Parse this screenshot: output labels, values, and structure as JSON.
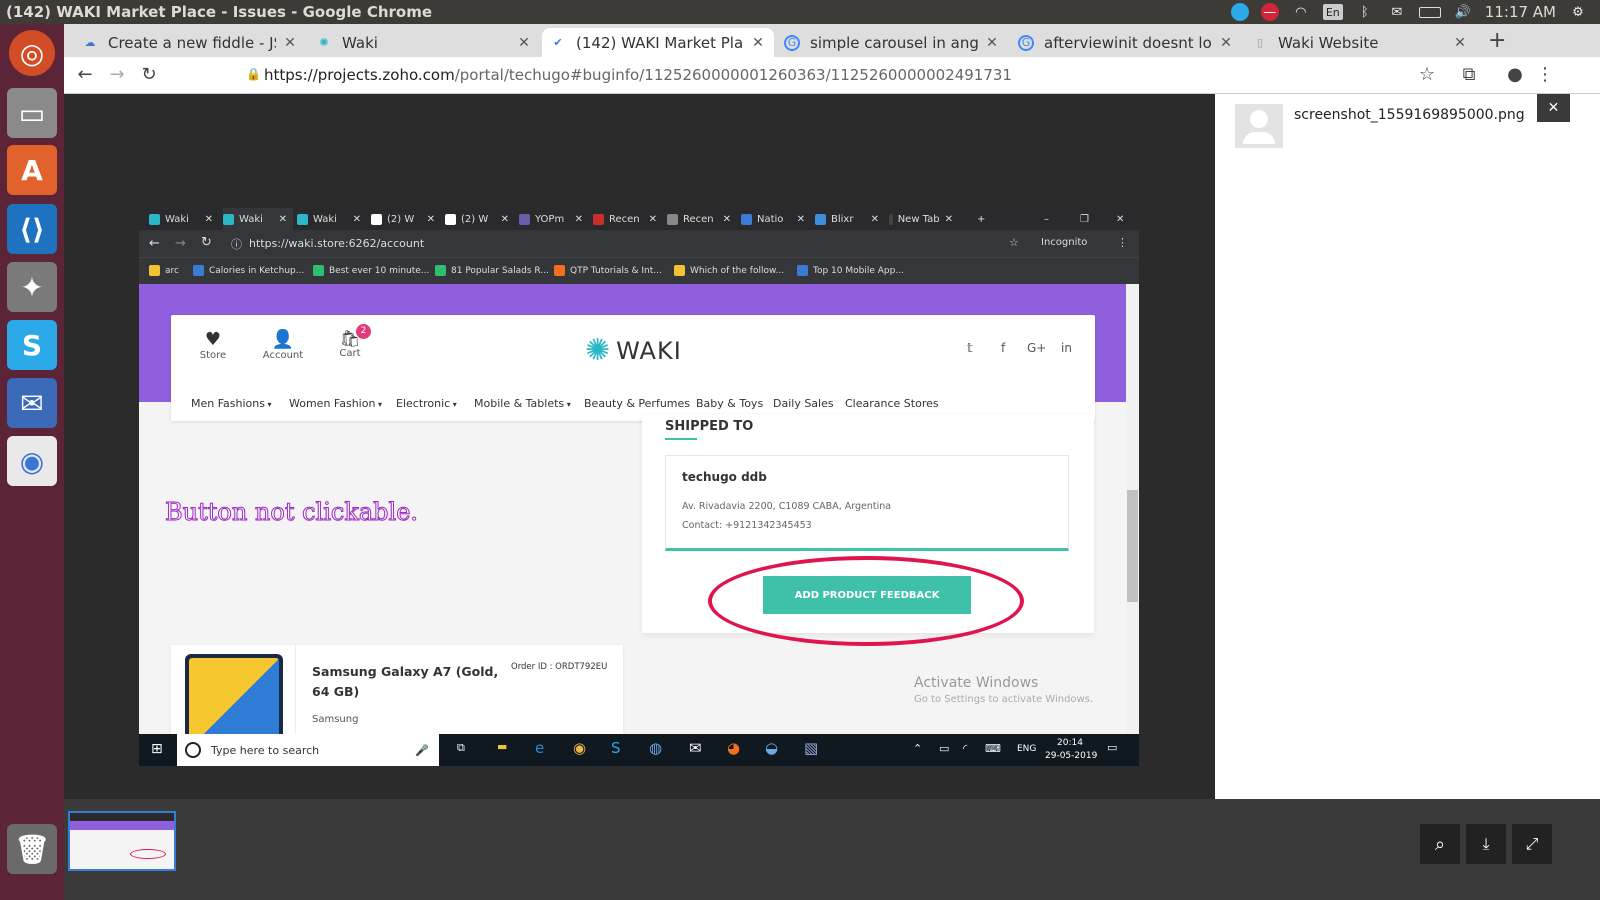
{
  "window_title": "(142) WAKI Market Place - Issues - Google Chrome",
  "tray": {
    "lang": "En",
    "time": "11:17 AM"
  },
  "chrome": {
    "tabs": [
      {
        "label": "Create a new fiddle - JSFiddle",
        "icon": "jsfiddle-icon"
      },
      {
        "label": "Waki",
        "icon": "waki-icon"
      },
      {
        "label": "(142) WAKI Market Place - Issues",
        "icon": "zoho-check-icon"
      },
      {
        "label": "simple carousel in angular",
        "icon": "google-icon"
      },
      {
        "label": "afterviewinit doesnt load",
        "icon": "google-icon"
      },
      {
        "label": "Waki Website",
        "icon": "page-icon"
      }
    ],
    "url_host": "https://projects.zoho.com",
    "url_path": "/portal/techugo#buginfo/112526000000126036​3/112526000000249173​1"
  },
  "viewer": {
    "filename": "screenshot_1559169895000.png",
    "close": "✕"
  },
  "inner": {
    "tabs": [
      "Waki",
      "Waki",
      "Waki",
      "(2) W",
      "(2) W",
      "YOPm",
      "Recen",
      "Recen",
      "Natio",
      "Blixr",
      "New Tab"
    ],
    "url": "https://waki.store:6262/account",
    "incognito": "Incognito",
    "bookmarks": [
      "arc",
      "Calories in Ketchup...",
      "Best ever 10 minute...",
      "81 Popular Salads R...",
      "QTP Tutorials & Int...",
      "Which of the follow...",
      "Top 10 Mobile App..."
    ],
    "header_items": [
      "Store",
      "Account",
      "Cart"
    ],
    "cart_count": "2",
    "logo": "WAKI",
    "nav": [
      "Men Fashions",
      "Women Fashion",
      "Electronic",
      "Mobile & Tablets",
      "Beauty & Perfumes",
      "Baby & Toys",
      "Daily Sales",
      "Clearance Stores"
    ],
    "annotation": "Button not clickable.",
    "shipped_to": "SHIPPED TO",
    "ship_name": "techugo ddb",
    "ship_address": "Av. Rivadavia 2200, C1089 CABA, Argentina",
    "ship_contact": "Contact: +9121342345453",
    "feedback_button": "ADD PRODUCT FEEDBACK",
    "product_name": "Samsung Galaxy A7 (Gold, 64 GB)",
    "order_id": "Order ID : ORDT792EU",
    "brand": "Samsung",
    "activate_title": "Activate Windows",
    "activate_sub": "Go to Settings to activate Windows.",
    "search_placeholder": "Type here to search",
    "lang": "ENG",
    "time": "20:14",
    "date": "29-05-2019"
  },
  "colors": {
    "accent": "#3ec1a8",
    "purple": "#8f5fde",
    "annotation": "#e0144f"
  }
}
